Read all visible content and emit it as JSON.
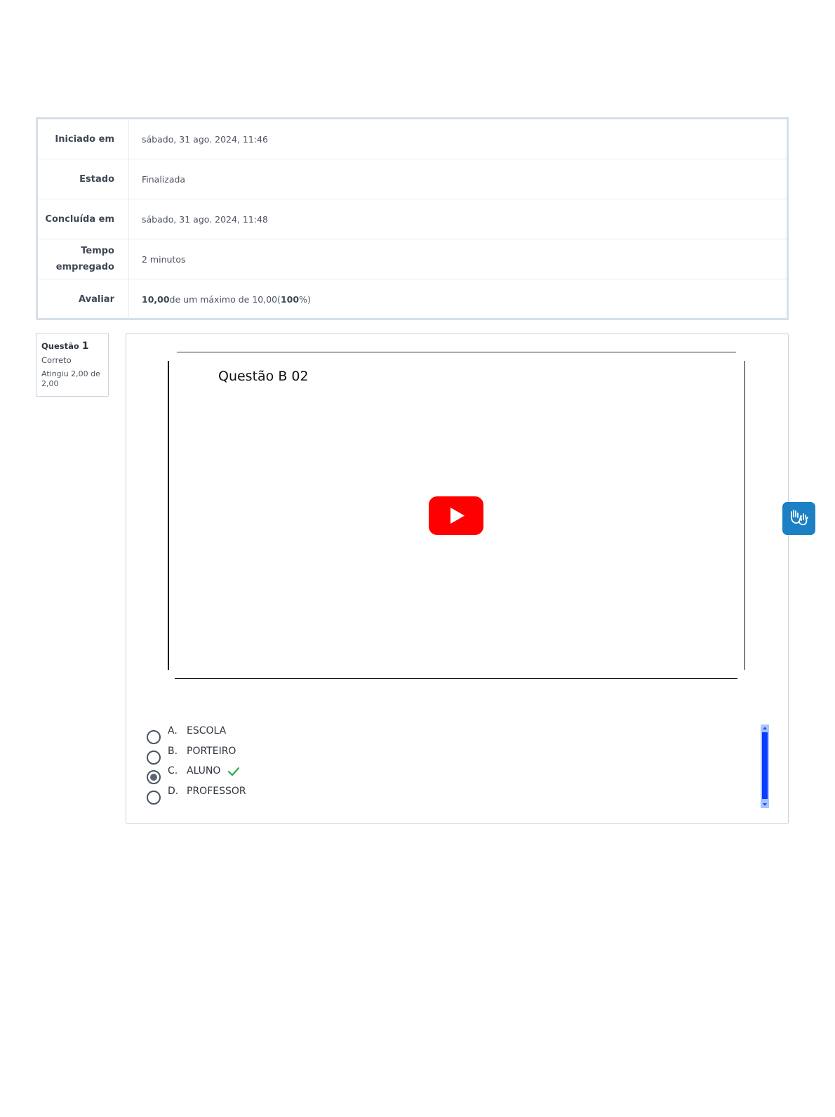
{
  "summary": {
    "rows": [
      {
        "label": "Iniciado em",
        "value": "sábado, 31 ago. 2024, 11:46"
      },
      {
        "label": "Estado",
        "value": "Finalizada"
      },
      {
        "label": "Concluída em",
        "value": "sábado, 31 ago. 2024, 11:48"
      },
      {
        "label": "Tempo empregado",
        "value": "2 minutos"
      },
      {
        "label": "Avaliar",
        "value_bold_1": "10,00",
        "value_mid": " de um máximo de 10,00(",
        "value_bold_2": "100",
        "value_end": "%)"
      }
    ]
  },
  "question_info": {
    "prefix": "Questão",
    "number": "1",
    "state": "Correto",
    "grade": "Atingiu 2,00 de 2,00"
  },
  "video": {
    "title": "Questão B 02",
    "play_icon": "youtube-play-icon"
  },
  "answers": [
    {
      "letter": "A.",
      "text": "ESCOLA",
      "selected": false
    },
    {
      "letter": "B.",
      "text": "PORTEIRO",
      "selected": false
    },
    {
      "letter": "C.",
      "text": "ALUNO",
      "selected": true,
      "correct": true
    },
    {
      "letter": "D.",
      "text": "PROFESSOR",
      "selected": false
    }
  ],
  "accessibility_widget": {
    "icon": "sign-language-hands-icon",
    "color": "#1b80c4"
  },
  "colors": {
    "youtube_red": "#ff0000",
    "correct_green": "#2eaa4a",
    "scroll_thumb": "#0a3dff"
  }
}
